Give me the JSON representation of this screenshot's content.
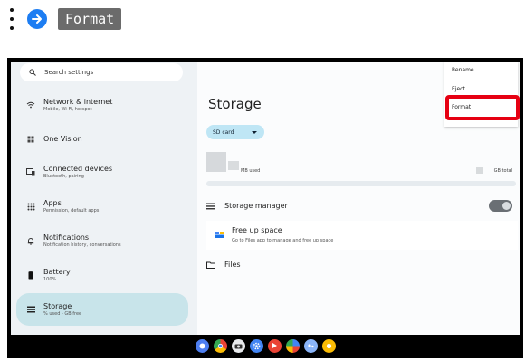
{
  "instruction": {
    "chip_label": "Format"
  },
  "search": {
    "placeholder": "Search settings"
  },
  "sidebar": {
    "items": [
      {
        "title": "Network & internet",
        "subtitle": "Mobile, Wi-Fi, hotspot"
      },
      {
        "title": "One Vision",
        "subtitle": ""
      },
      {
        "title": "Connected devices",
        "subtitle": "Bluetooth, pairing"
      },
      {
        "title": "Apps",
        "subtitle": "Permission, default apps"
      },
      {
        "title": "Notifications",
        "subtitle": "Notification history, conversations"
      },
      {
        "title": "Battery",
        "subtitle": "100%"
      },
      {
        "title": "Storage",
        "subtitle": "% used - GB free"
      }
    ]
  },
  "main": {
    "title": "Storage",
    "sd_button": "SD card",
    "used_label": "MB used",
    "total_label": "GB total",
    "storage_manager": "Storage manager",
    "free_up_title": "Free up space",
    "free_up_subtitle": "Go to Files app to manage and free up space",
    "files": "Files"
  },
  "menu": {
    "items": [
      "Rename",
      "Eject",
      "Format"
    ]
  },
  "colors": {
    "highlight": "#e60012",
    "accent": "#1d7df2",
    "active_nav": "#c8e4ea"
  }
}
